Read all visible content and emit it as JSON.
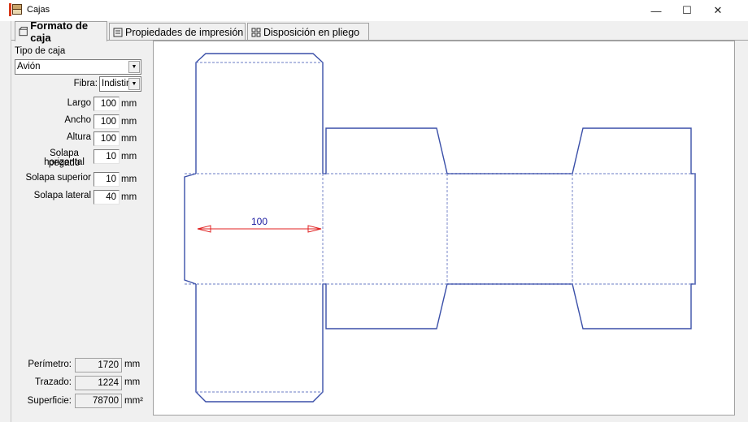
{
  "window": {
    "title": "Cajas",
    "minimize_glyph": "—",
    "maximize_glyph": "☐",
    "close_glyph": "✕"
  },
  "tabs": [
    {
      "label": "Formato de caja",
      "icon": "box-format-icon",
      "active": true
    },
    {
      "label": "Propiedades de impresión",
      "icon": "print-properties-icon",
      "active": false
    },
    {
      "label": "Disposición en pliego",
      "icon": "sheet-layout-icon",
      "active": false
    }
  ],
  "form": {
    "box_type_label": "Tipo de caja",
    "box_type_value": "Avión",
    "fiber_label": "Fibra:",
    "fiber_value": "Indistinta",
    "length_label": "Largo",
    "length_value": "100",
    "width_label": "Ancho",
    "width_value": "100",
    "height_label": "Altura",
    "height_value": "100",
    "glue_flap_label_1": "Solapa pegado",
    "glue_flap_label_2": "horizontal",
    "glue_flap_value": "10",
    "top_flap_label": "Solapa superior",
    "top_flap_value": "10",
    "side_flap_label": "Solapa lateral",
    "side_flap_value": "40",
    "unit": "mm"
  },
  "stats": {
    "perimeter_label": "Perímetro:",
    "perimeter_value": "1720",
    "perimeter_unit": "mm",
    "trace_label": "Trazado:",
    "trace_value": "1224",
    "trace_unit": "mm",
    "surface_label": "Superficie:",
    "surface_value": "78700",
    "surface_unit": "mm²"
  },
  "drawing": {
    "dimension_label": "100",
    "cut_color": "#3a4fa8",
    "fold_color": "#6a7bc4",
    "dimension_color": "#e02020",
    "dimension_text_color": "#1a1aa0"
  }
}
